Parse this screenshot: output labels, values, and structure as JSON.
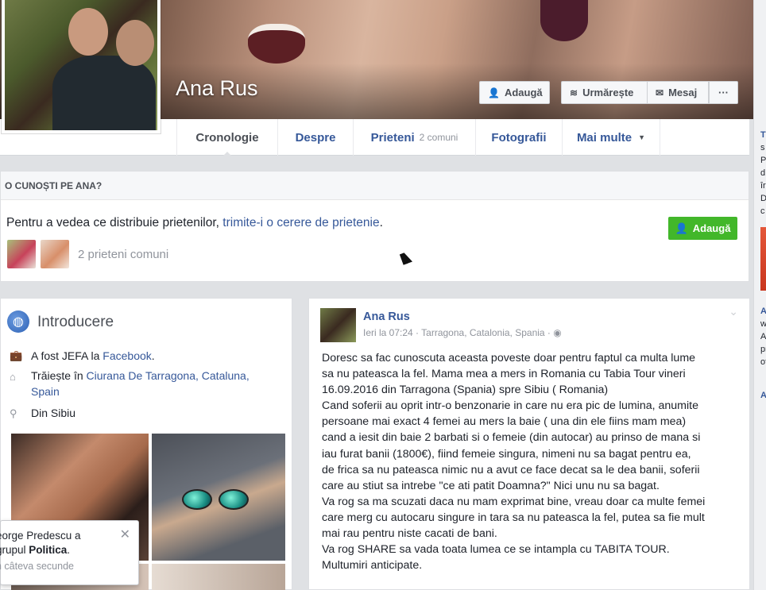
{
  "profile": {
    "name": "Ana Rus"
  },
  "cover_buttons": {
    "add": "Adaugă",
    "follow": "Urmărește",
    "message": "Mesaj",
    "more": "···"
  },
  "tabs": [
    {
      "label": "Cronologie"
    },
    {
      "label": "Despre"
    },
    {
      "label": "Prieteni",
      "sub": "2 comuni"
    },
    {
      "label": "Fotografii"
    },
    {
      "label": "Mai multe"
    }
  ],
  "know_panel": {
    "header": "O CUNOȘTI PE ANA?",
    "text_before": "Pentru a vedea ce distribuie prietenilor, ",
    "text_link": "trimite-i o cerere de prietenie",
    "text_after": ".",
    "add_button": "Adaugă",
    "mutual_friends": "2 prieteni comuni"
  },
  "intro": {
    "title": "Introducere",
    "items": [
      {
        "icon": "briefcase-icon",
        "text": "A fost JEFA la ",
        "link": "Facebook",
        "suffix": "."
      },
      {
        "icon": "home-icon",
        "text": "Trăiește în ",
        "link": "Ciurana De Tarragona, Cataluna, Spain",
        "suffix": ""
      },
      {
        "icon": "location-pin-icon",
        "text": "Din Sibiu",
        "link": "",
        "suffix": ""
      }
    ]
  },
  "post": {
    "author": "Ana Rus",
    "meta": "Ieri la 07:24 · Tarragona, Catalonia, Spania ·",
    "privacy_icon": "globe-icon",
    "lines": [
      "Doresc sa fac cunoscuta aceasta poveste doar pentru faptul ca multa lume",
      "sa nu pateasca la fel. Mama mea a mers in Romania cu Tabia Tour vineri",
      "16.09.2016 din Tarragona (Spania) spre Sibiu ( Romania)",
      "Cand soferii au oprit intr-o benzonarie in care nu era pic de lumina, anumite",
      "persoane mai exact 4 femei au mers la baie ( una din ele fiins mam mea)",
      "cand a iesit din baie 2 barbati si o femeie (din autocar) au prinso de mana si",
      "iau furat banii (1800€), fiind femeie singura, nimeni nu sa bagat pentru ea,",
      "de frica sa nu pateasca nimic nu a avut ce face decat sa le dea banii, soferii",
      "care au stiut sa intrebe \"ce ati patit Doamna?\" Nici unu nu sa bagat.",
      "Va rog sa ma scuzati daca nu mam exprimat bine, vreau doar ca multe femei",
      "care merg cu autocaru singure in tara sa nu pateasca la fel, putea sa fie mult",
      "mai rau pentru niste cacati de bani.",
      "Va rog SHARE sa vada toata lumea ce se intampla cu TABITA TOUR.",
      "Multumiri anticipate."
    ]
  },
  "toast": {
    "line1": "eorge Predescu a",
    "line2_prefix": "grupul ",
    "line2_bold": "Politica",
    "line2_suffix": ".",
    "time": "n câteva secunde"
  },
  "right_strip": {
    "lines_top": [
      "T",
      "s",
      "P",
      "d",
      "îr",
      "D",
      "c"
    ],
    "lines_bottom": [
      "A",
      "w",
      "A",
      "pr",
      "of",
      "A"
    ]
  }
}
